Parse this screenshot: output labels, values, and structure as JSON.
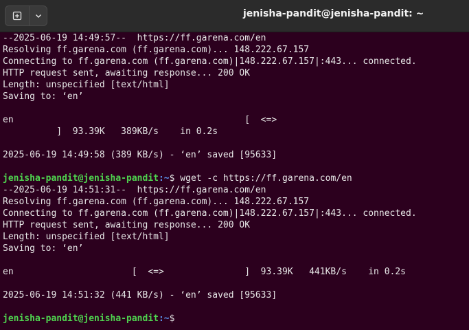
{
  "window": {
    "title": "jenisha-pandit@jenisha-pandit: ~"
  },
  "icons": {
    "new_tab": "new-tab-icon",
    "menu": "chevron-down-icon"
  },
  "colors": {
    "background": "#2c001e",
    "prompt_user": "#4fd44f",
    "prompt_path": "#5b8fe9",
    "text": "#e7e7e7"
  },
  "terminal": {
    "lines": [
      "--2025-06-19 14:49:57--  https://ff.garena.com/en",
      "Resolving ff.garena.com (ff.garena.com)... 148.222.67.157",
      "Connecting to ff.garena.com (ff.garena.com)|148.222.67.157|:443... connected.",
      "HTTP request sent, awaiting response... 200 OK",
      "Length: unspecified [text/html]",
      "Saving to: ‘en’",
      "",
      "en                                           [  <=>",
      "          ]  93.39K   389KB/s    in 0.2s",
      "",
      "2025-06-19 14:49:58 (389 KB/s) - ‘en’ saved [95633]",
      ""
    ],
    "prompt1": {
      "user": "jenisha-pandit@jenisha-pandit",
      "path": ":~",
      "sign": "$ ",
      "command": "wget -c https://ff.garena.com/en"
    },
    "lines2": [
      "--2025-06-19 14:51:31--  https://ff.garena.com/en",
      "Resolving ff.garena.com (ff.garena.com)... 148.222.67.157",
      "Connecting to ff.garena.com (ff.garena.com)|148.222.67.157|:443... connected.",
      "HTTP request sent, awaiting response... 200 OK",
      "Length: unspecified [text/html]",
      "Saving to: ‘en’",
      "",
      "en                      [  <=>               ]  93.39K   441KB/s    in 0.2s",
      "",
      "2025-06-19 14:51:32 (441 KB/s) - ‘en’ saved [95633]",
      ""
    ],
    "prompt2": {
      "user": "jenisha-pandit@jenisha-pandit",
      "path": ":~",
      "sign": "$"
    }
  }
}
